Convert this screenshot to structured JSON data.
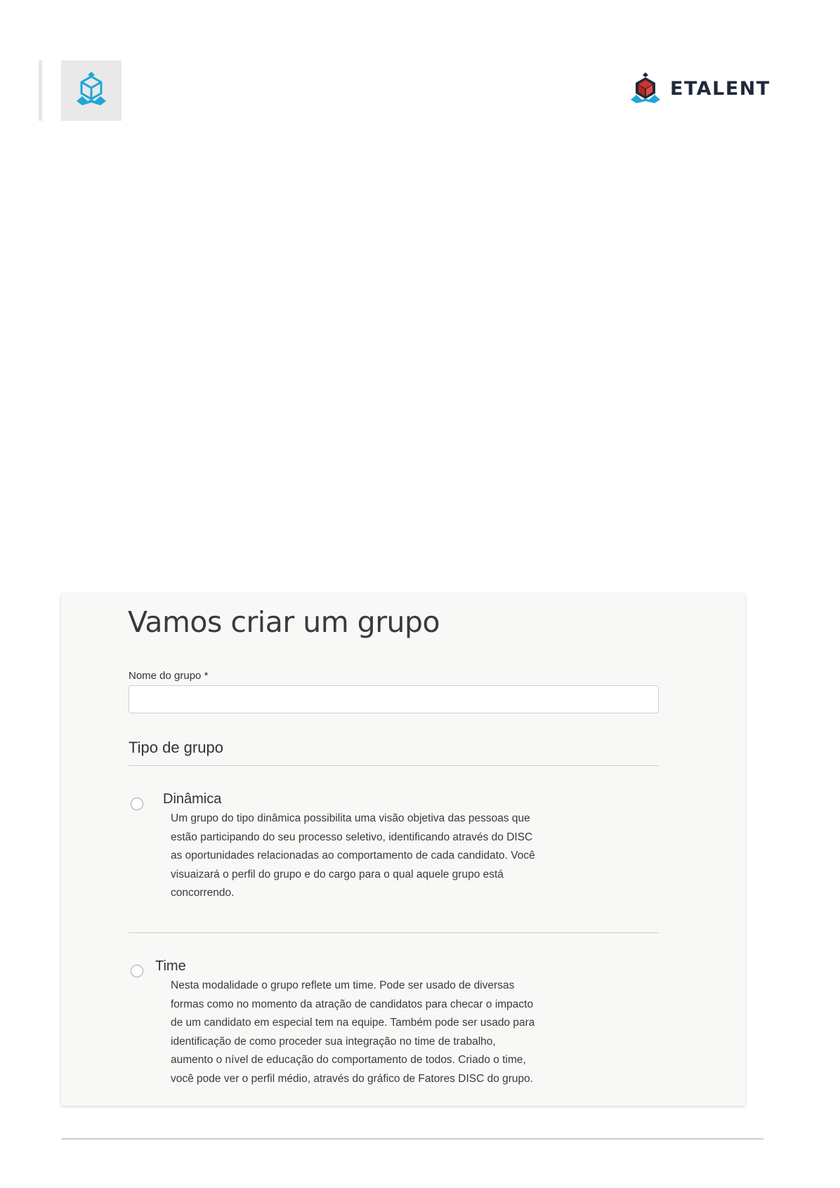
{
  "header": {
    "icon": "cube-logo-icon",
    "brand": {
      "logo_icon": "etalent-logo-icon",
      "name": "ETALENT",
      "colors": {
        "primary": "#1f2a3c",
        "accent_red": "#d9302c",
        "accent_blue": "#1fa6d8"
      }
    }
  },
  "form": {
    "title": "Vamos criar um grupo",
    "name_field": {
      "label": "Nome do grupo *",
      "value": "",
      "placeholder": ""
    },
    "group_type": {
      "heading": "Tipo de grupo",
      "options": [
        {
          "title": "Dinâmica",
          "selected": false,
          "description": [
            "Um grupo do tipo dinâmica possibilita uma visão objetiva das pessoas que",
            "estão participando do seu processo seletivo, identificando através do DISC",
            "as oportunidades relacionadas ao comportamento de cada candidato. Você",
            "visuaizará o perfil do grupo e do cargo para o qual aquele grupo está",
            "concorrendo."
          ]
        },
        {
          "title": "Time",
          "selected": false,
          "description": [
            "Nesta modalidade o grupo reflete um time. Pode ser usado de diversas",
            "formas como no momento da atração de candidatos para checar o impacto",
            "de um candidato em especial tem na equipe. Também pode ser usado para",
            "identificação de como proceder sua integração no time de trabalho,",
            "aumento o nível de educação do comportamento de todos. Criado o time,",
            "você pode ver o perfil médio, através do gráfico de Fatores DISC do grupo."
          ]
        }
      ]
    }
  }
}
